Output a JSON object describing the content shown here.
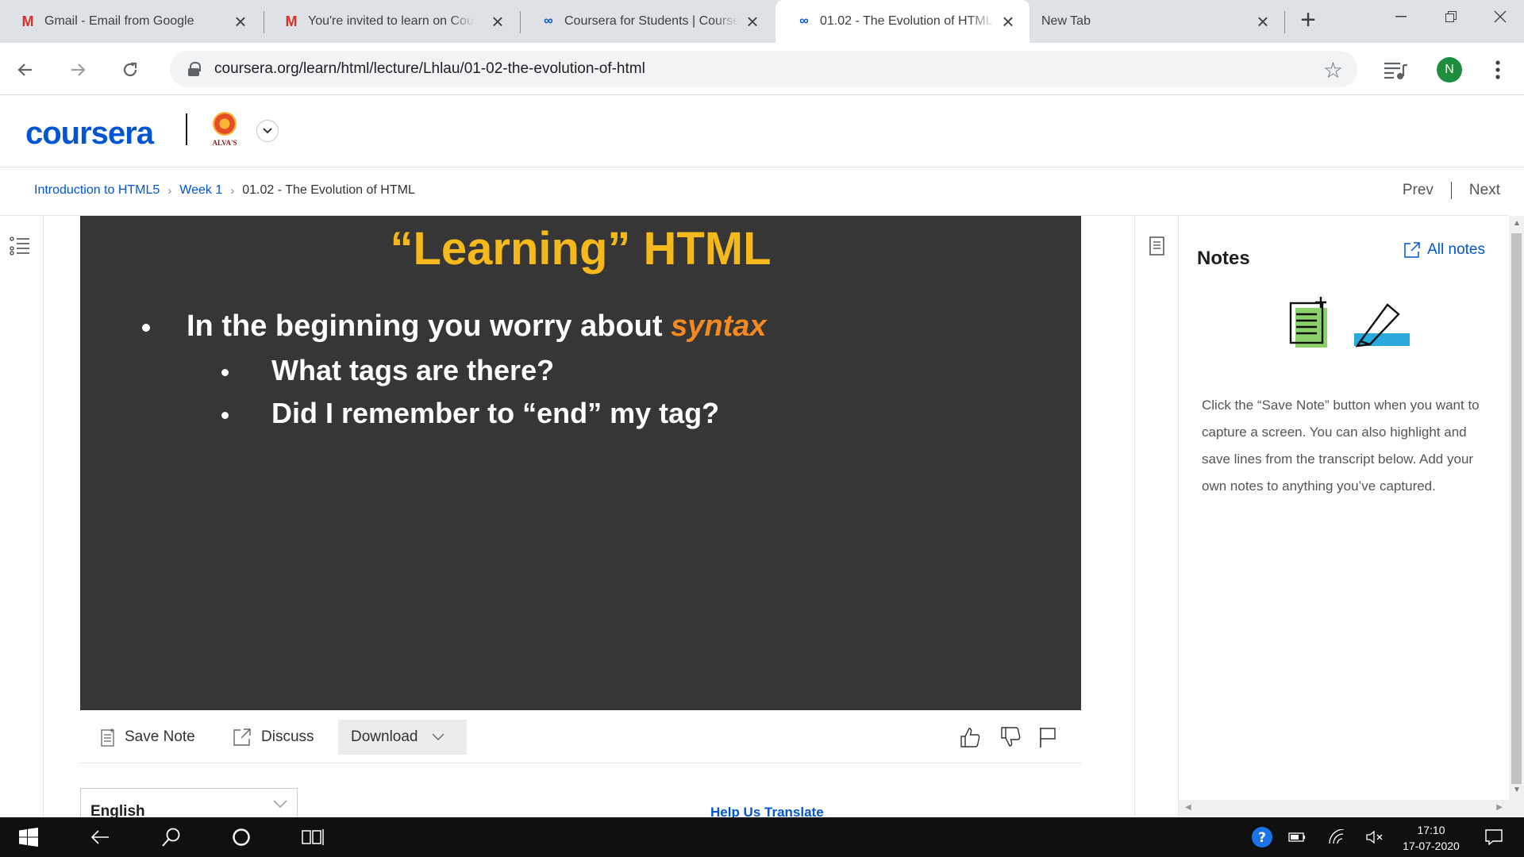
{
  "browser": {
    "tabs": [
      {
        "title": "Gmail - Email from Google",
        "favicon": "gmail-icon"
      },
      {
        "title": "You're invited to learn on Coursera",
        "favicon": "gmail-icon"
      },
      {
        "title": "Coursera for Students | Coursera",
        "favicon": "coursera-icon"
      },
      {
        "title": "01.02 - The Evolution of HTML",
        "favicon": "coursera-icon",
        "active": true
      },
      {
        "title": "New Tab",
        "favicon": "none"
      }
    ],
    "url": "coursera.org/learn/html/lecture/Lhlau/01-02-the-evolution-of-html",
    "avatar_initial": "N"
  },
  "site": {
    "logo": "coursera",
    "partner_label": "ALVA'S"
  },
  "breadcrumb": {
    "course": "Introduction to HTML5",
    "week": "Week 1",
    "current": "01.02 - The Evolution of HTML"
  },
  "pager": {
    "prev": "Prev",
    "next": "Next"
  },
  "slide": {
    "title": "“Learning” HTML",
    "bullet1_prefix": "In the beginning you worry about ",
    "bullet1_accent": "syntax",
    "sub1": "What tags are there?",
    "sub2": "Did I remember to “end” my tag?"
  },
  "actions": {
    "save_note": "Save Note",
    "discuss": "Discuss",
    "download": "Download"
  },
  "transcript": {
    "language": "English",
    "help_translate": "Help Us Translate"
  },
  "notes": {
    "title": "Notes",
    "all_notes": "All notes",
    "help_text": "Click the “Save Note” button when you want to capture a screen. You can also highlight and save lines from the transcript below. Add your own notes to anything you’ve captured."
  },
  "taskbar": {
    "time": "17:10",
    "date": "17-07-2020"
  },
  "colors": {
    "brand": "#0056d2",
    "slide_bg": "#363636",
    "slide_title": "#f5b91c",
    "slide_accent": "#f58b1f"
  }
}
